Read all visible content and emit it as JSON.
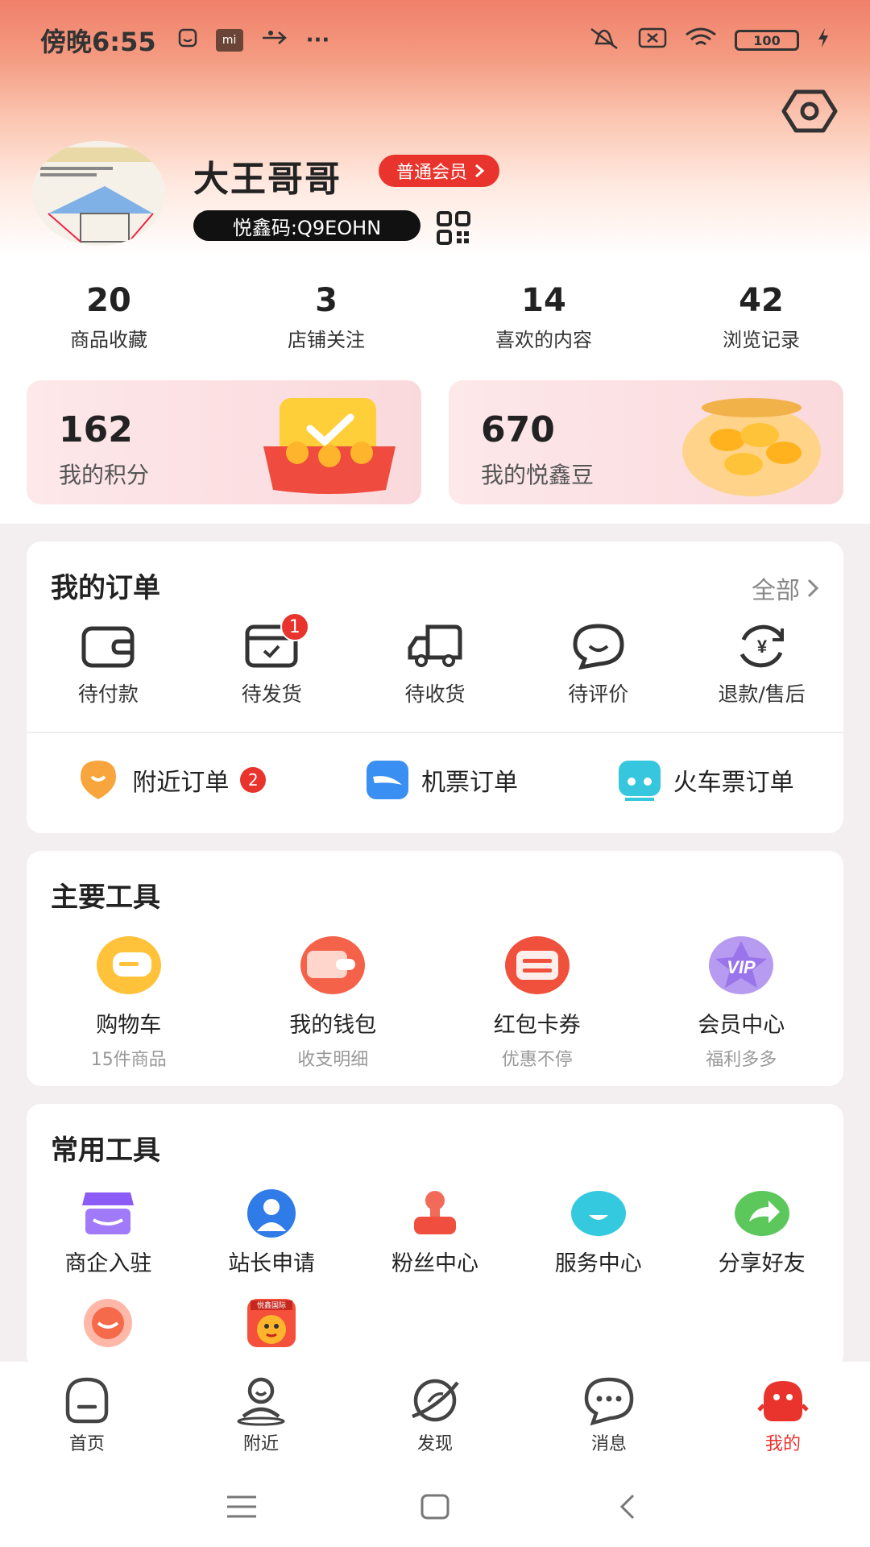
{
  "status_bar": {
    "time": "傍晚6:55",
    "mi_label": "mi",
    "more": "···",
    "battery": "100"
  },
  "profile": {
    "username": "大王哥哥",
    "member_badge": "普通会员",
    "code": "悦鑫码:Q9EOHN"
  },
  "stats": [
    {
      "value": "20",
      "label": "商品收藏"
    },
    {
      "value": "3",
      "label": "店铺关注"
    },
    {
      "value": "14",
      "label": "喜欢的内容"
    },
    {
      "value": "42",
      "label": "浏览记录"
    }
  ],
  "assets": {
    "points": {
      "value": "162",
      "label": "我的积分"
    },
    "beans": {
      "value": "670",
      "label": "我的悦鑫豆"
    }
  },
  "orders": {
    "title": "我的订单",
    "all_link": "全部",
    "items": [
      {
        "label": "待付款",
        "icon": "wallet-icon"
      },
      {
        "label": "待发货",
        "icon": "package-icon",
        "badge": "1"
      },
      {
        "label": "待收货",
        "icon": "truck-icon"
      },
      {
        "label": "待评价",
        "icon": "comment-icon"
      },
      {
        "label": "退款/售后",
        "icon": "refund-icon"
      }
    ],
    "quick": [
      {
        "label": "附近订单",
        "badge": "2",
        "icon": "location-icon",
        "color": "#f7a53c"
      },
      {
        "label": "机票订单",
        "icon": "plane-icon",
        "color": "#3a8ff2"
      },
      {
        "label": "火车票订单",
        "icon": "train-icon",
        "color": "#36c6dd"
      }
    ]
  },
  "main_tools": {
    "title": "主要工具",
    "items": [
      {
        "label": "购物车",
        "sub": "15件商品",
        "icon": "cart-icon"
      },
      {
        "label": "我的钱包",
        "sub": "收支明细",
        "icon": "wallet-tool-icon"
      },
      {
        "label": "红包卡券",
        "sub": "优惠不停",
        "icon": "coupon-icon"
      },
      {
        "label": "会员中心",
        "sub": "福利多多",
        "icon": "vip-icon",
        "vip_text": "VIP"
      }
    ]
  },
  "common_tools": {
    "title": "常用工具",
    "items": [
      {
        "label": "商企入驻",
        "icon": "store-icon"
      },
      {
        "label": "站长申请",
        "icon": "person-icon"
      },
      {
        "label": "粉丝中心",
        "icon": "stamp-icon"
      },
      {
        "label": "服务中心",
        "icon": "service-icon"
      },
      {
        "label": "分享好友",
        "icon": "share-icon"
      }
    ],
    "row2_logo_text": "悦鑫国际"
  },
  "bottom_nav": [
    {
      "label": "首页",
      "icon": "home-icon"
    },
    {
      "label": "附近",
      "icon": "nearby-icon"
    },
    {
      "label": "发现",
      "icon": "discover-icon"
    },
    {
      "label": "消息",
      "icon": "message-icon"
    },
    {
      "label": "我的",
      "icon": "mine-icon",
      "active": true
    }
  ]
}
